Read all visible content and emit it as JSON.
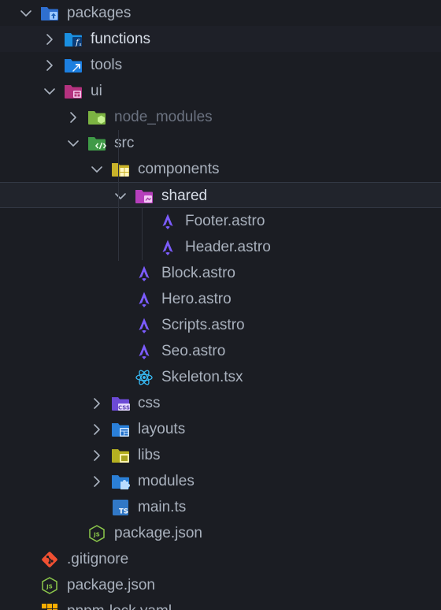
{
  "explorer": {
    "items": [
      {
        "name": "packages",
        "type": "folder",
        "icon": "folder-packages-icon",
        "state": "expanded"
      },
      {
        "name": "functions",
        "type": "folder",
        "icon": "folder-functions-icon",
        "state": "collapsed",
        "highlight": "hover"
      },
      {
        "name": "tools",
        "type": "folder",
        "icon": "folder-tools-icon",
        "state": "collapsed"
      },
      {
        "name": "ui",
        "type": "folder",
        "icon": "folder-ui-icon",
        "state": "expanded"
      },
      {
        "name": "node_modules",
        "type": "folder",
        "icon": "folder-node-icon",
        "state": "collapsed",
        "dimmed": true
      },
      {
        "name": "src",
        "type": "folder",
        "icon": "folder-src-icon",
        "state": "expanded"
      },
      {
        "name": "components",
        "type": "folder",
        "icon": "folder-components-icon",
        "state": "expanded"
      },
      {
        "name": "shared",
        "type": "folder",
        "icon": "folder-shared-icon",
        "state": "expanded",
        "highlight": "selected"
      },
      {
        "name": "Footer.astro",
        "type": "file",
        "icon": "astro-file-icon"
      },
      {
        "name": "Header.astro",
        "type": "file",
        "icon": "astro-file-icon"
      },
      {
        "name": "Block.astro",
        "type": "file",
        "icon": "astro-file-icon"
      },
      {
        "name": "Hero.astro",
        "type": "file",
        "icon": "astro-file-icon"
      },
      {
        "name": "Scripts.astro",
        "type": "file",
        "icon": "astro-file-icon"
      },
      {
        "name": "Seo.astro",
        "type": "file",
        "icon": "astro-file-icon"
      },
      {
        "name": "Skeleton.tsx",
        "type": "file",
        "icon": "react-file-icon"
      },
      {
        "name": "css",
        "type": "folder",
        "icon": "folder-css-icon",
        "state": "collapsed"
      },
      {
        "name": "layouts",
        "type": "folder",
        "icon": "folder-layouts-icon",
        "state": "collapsed"
      },
      {
        "name": "libs",
        "type": "folder",
        "icon": "folder-libs-icon",
        "state": "collapsed"
      },
      {
        "name": "modules",
        "type": "folder",
        "icon": "folder-modules-icon",
        "state": "collapsed"
      },
      {
        "name": "main.ts",
        "type": "file",
        "icon": "typescript-file-icon"
      },
      {
        "name": "package.json",
        "type": "file",
        "icon": "nodejs-file-icon"
      },
      {
        "name": ".gitignore",
        "type": "file",
        "icon": "git-file-icon"
      },
      {
        "name": "package.json",
        "type": "file",
        "icon": "nodejs-file-icon"
      },
      {
        "name": "pnpm-lock.yaml",
        "type": "file",
        "icon": "pnpm-file-icon"
      }
    ]
  },
  "colors": {
    "background": "#1b1d23",
    "text": "#a9b1bd",
    "text_bright": "#d8dee8",
    "text_dimmed": "#6b7280",
    "selected_row": "#21242c",
    "astro": "#7c5cff",
    "react": "#38bdf8",
    "typescript": "#3178c6",
    "node": "#8cc84b",
    "git": "#f05032"
  }
}
